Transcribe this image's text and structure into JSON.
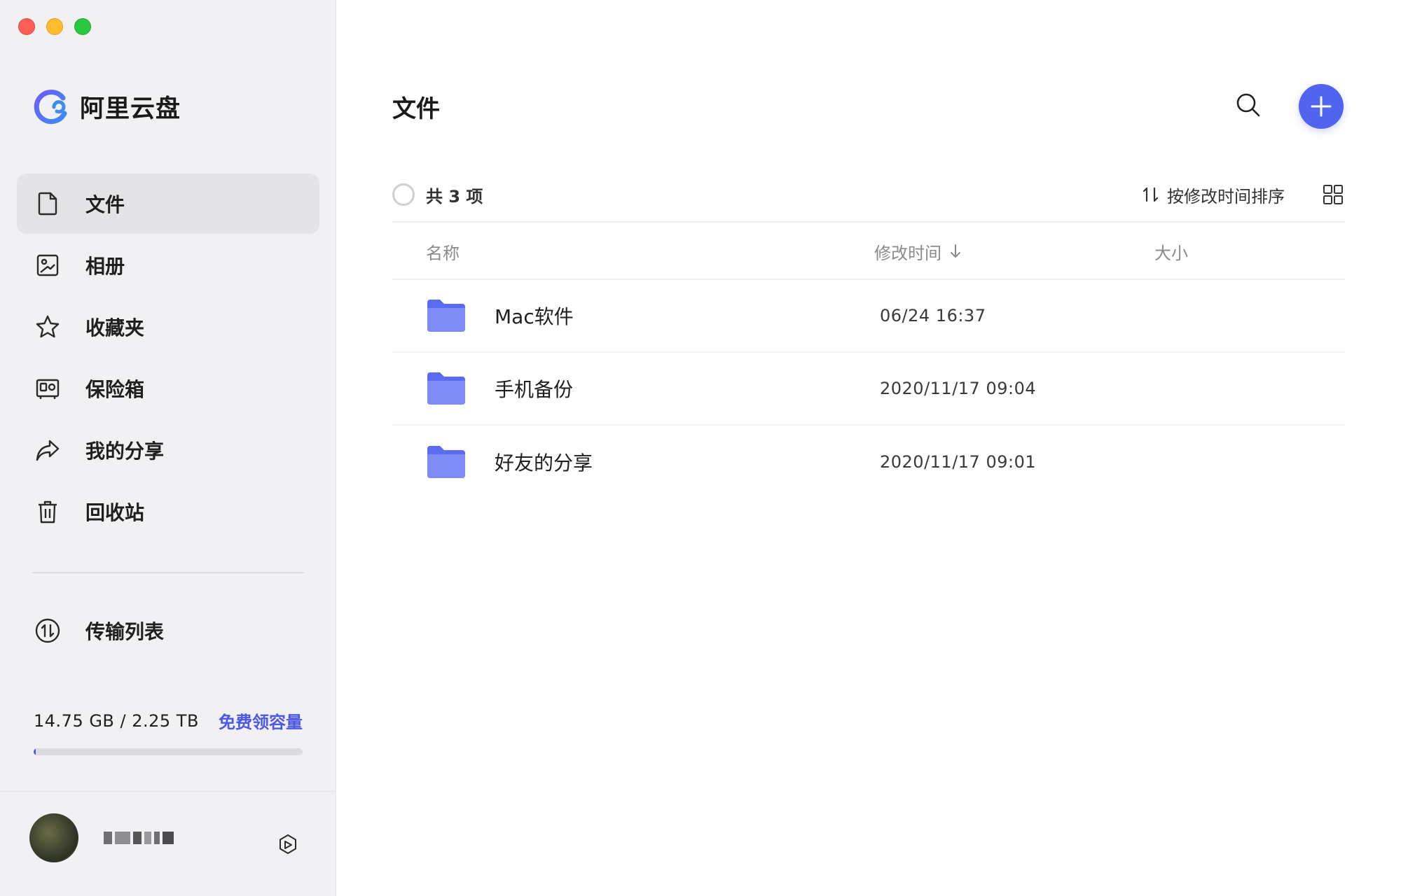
{
  "app": {
    "name": "阿里云盘",
    "accent": "#5064f0"
  },
  "sidebar": {
    "items": [
      {
        "label": "文件",
        "icon": "file-icon",
        "active": true
      },
      {
        "label": "相册",
        "icon": "photo-album-icon",
        "active": false
      },
      {
        "label": "收藏夹",
        "icon": "star-icon",
        "active": false
      },
      {
        "label": "保险箱",
        "icon": "safe-icon",
        "active": false
      },
      {
        "label": "我的分享",
        "icon": "share-icon",
        "active": false
      },
      {
        "label": "回收站",
        "icon": "trash-icon",
        "active": false
      }
    ],
    "transfer": {
      "label": "传输列表",
      "icon": "transfer-icon"
    },
    "storage": {
      "used_text": "14.75 GB / 2.25 TB",
      "link": "免费领容量",
      "used_fraction": 0.0066
    },
    "settings_icon": "settings-icon"
  },
  "main": {
    "title": "文件",
    "toolbar": {
      "count": "共 3 项",
      "sort_label": "按修改时间排序"
    },
    "columns": {
      "name": "名称",
      "time": "修改时间",
      "size": "大小"
    },
    "rows": [
      {
        "name": "Mac软件",
        "time": "06/24 16:37",
        "size": ""
      },
      {
        "name": "手机备份",
        "time": "2020/11/17 09:04",
        "size": ""
      },
      {
        "name": "好友的分享",
        "time": "2020/11/17 09:01",
        "size": ""
      }
    ]
  }
}
